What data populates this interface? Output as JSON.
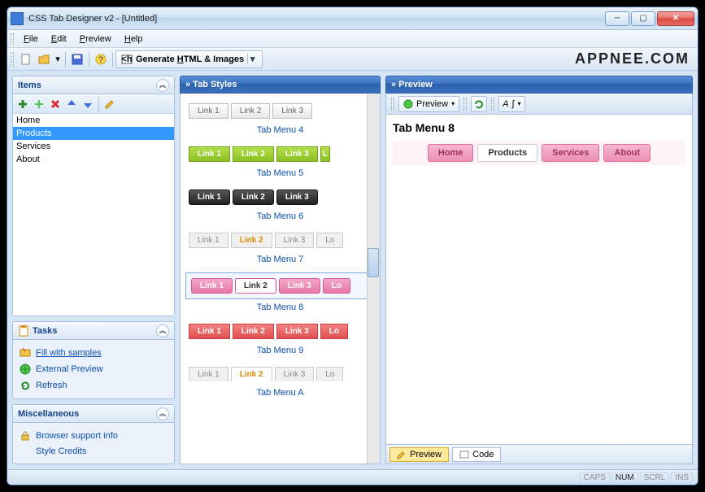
{
  "title": "CSS Tab Designer v2 - [Untitled]",
  "brand": "APPNEE.COM",
  "menu": {
    "file": "File",
    "edit": "Edit",
    "preview": "Preview",
    "help": "Help"
  },
  "toolbar": {
    "generate": "Generate HTML & Images"
  },
  "panels": {
    "items": {
      "title": "Items",
      "list": [
        "Home",
        "Products",
        "Services",
        "About"
      ],
      "selected": 1
    },
    "tasks": {
      "title": "Tasks",
      "fill": "Fill with samples",
      "ext": "External Preview",
      "refresh": "Refresh"
    },
    "misc": {
      "title": "Miscellaneous",
      "browser": "Browser support info",
      "credits": "Style Credits"
    }
  },
  "tabstyles": {
    "title": "» Tab Styles",
    "links": [
      "Link 1",
      "Link 2",
      "Link 3",
      "Longer Link"
    ],
    "labels": {
      "m4": "Tab Menu 4",
      "m5": "Tab Menu 5",
      "m6": "Tab Menu 6",
      "m7": "Tab Menu 7",
      "m8": "Tab Menu 8",
      "m9": "Tab Menu 9",
      "ma": "Tab Menu A"
    }
  },
  "preview": {
    "title": "» Preview",
    "btn": "Preview",
    "heading": "Tab Menu 8",
    "tabs": [
      "Home",
      "Products",
      "Services",
      "About"
    ],
    "active": 1,
    "footer": {
      "preview": "Preview",
      "code": "Code"
    }
  },
  "status": {
    "caps": "CAPS",
    "num": "NUM",
    "scrl": "SCRL",
    "ins": "INS"
  }
}
